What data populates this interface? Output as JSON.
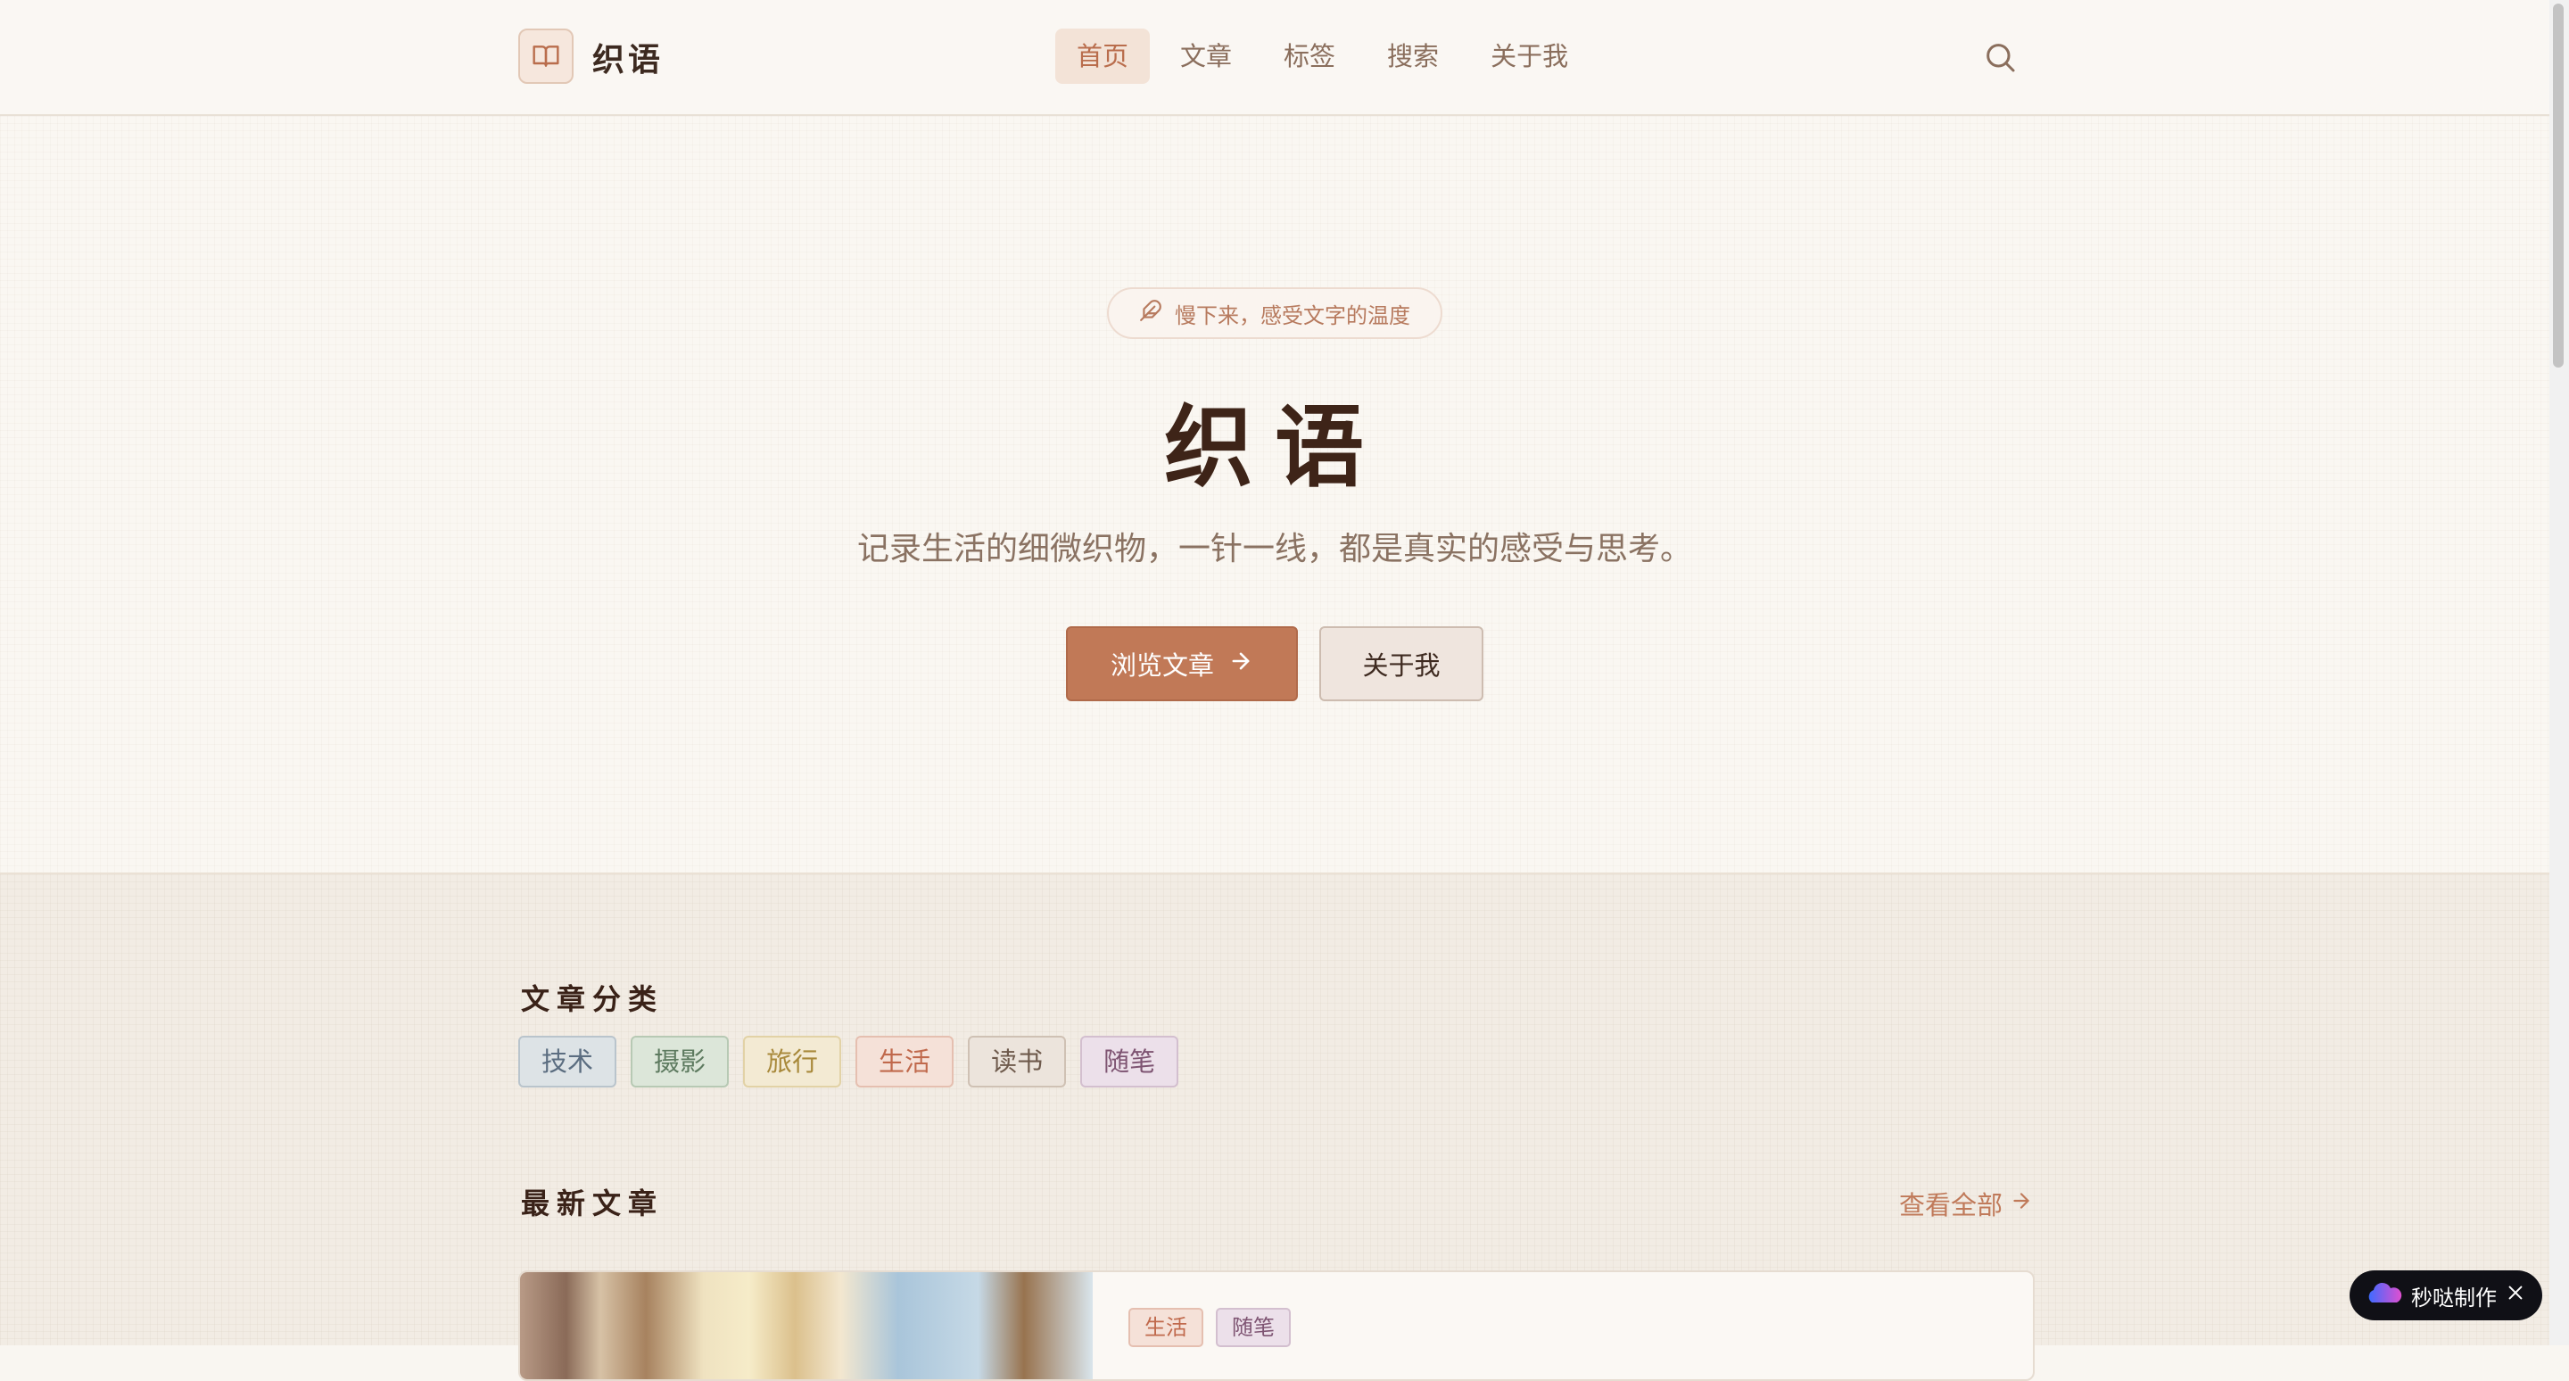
{
  "header": {
    "logo_text": "织语",
    "nav": [
      "首页",
      "文章",
      "标签",
      "搜索",
      "关于我"
    ]
  },
  "hero": {
    "pill_text": "慢下来，感受文字的温度",
    "title": "织语",
    "subtitle": "记录生活的细微织物，一针一线，都是真实的感受与思考。",
    "primary_button": "浏览文章",
    "secondary_button": "关于我"
  },
  "categories": {
    "heading": "文章分类",
    "tags": [
      {
        "label": "技术",
        "color": "#5b6d80",
        "bg": "#dde3e6",
        "border": "#b9c4cc"
      },
      {
        "label": "摄影",
        "color": "#5d7a5f",
        "bg": "#dce6d9",
        "border": "#b7c9b4"
      },
      {
        "label": "旅行",
        "color": "#a8893b",
        "bg": "#f3ead3",
        "border": "#e2d2a6"
      },
      {
        "label": "生活",
        "color": "#c0694c",
        "bg": "#f5e1d8",
        "border": "#e5bfb0"
      },
      {
        "label": "读书",
        "color": "#6e5a4c",
        "bg": "#ece4dc",
        "border": "#cfc1b4"
      },
      {
        "label": "随笔",
        "color": "#7e5472",
        "bg": "#ece0ea",
        "border": "#d3bfcf"
      }
    ]
  },
  "latest": {
    "heading": "最新文章",
    "view_all": "查看全部",
    "card_tags": [
      {
        "label": "生活",
        "color": "#c0694c",
        "bg": "#f5e1d8",
        "border": "#e5bfb0"
      },
      {
        "label": "随笔",
        "color": "#7e5472",
        "bg": "#ece0ea",
        "border": "#d3bfcf"
      }
    ]
  },
  "badge": {
    "label": "秒哒制作"
  }
}
